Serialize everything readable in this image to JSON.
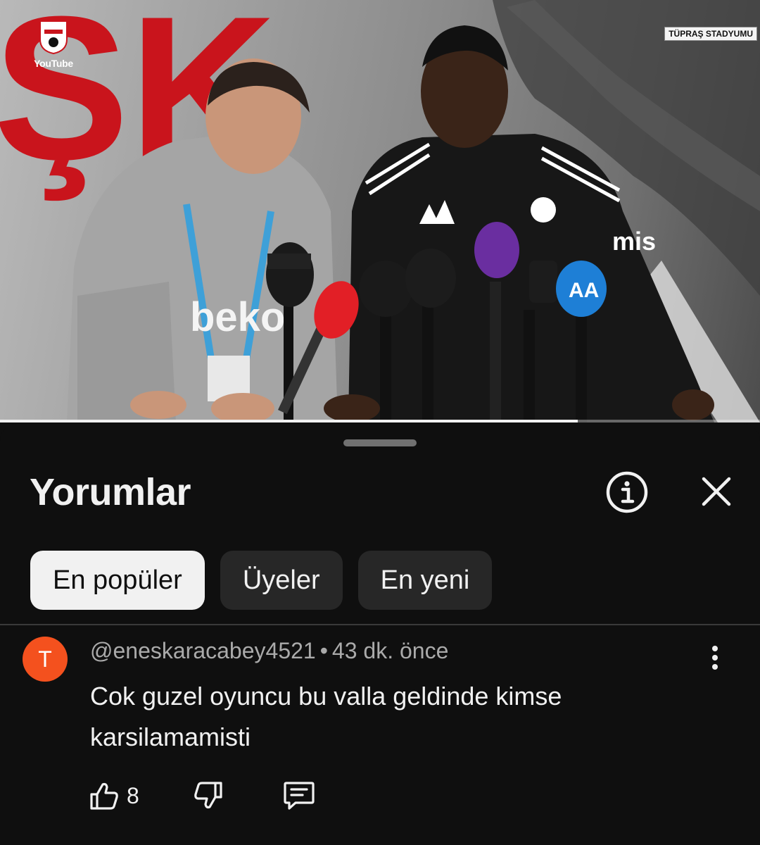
{
  "video": {
    "channel_logo_text": "YouTube",
    "stadium_label": "TÜPRAŞ STADYUMU",
    "backdrop_letters": "ŞK",
    "progress_fraction": 0.76
  },
  "comments_sheet": {
    "title": "Yorumlar",
    "icons": {
      "info": "info-icon",
      "close": "close-icon"
    },
    "filters": [
      {
        "label": "En popüler",
        "active": true
      },
      {
        "label": "Üyeler",
        "active": false
      },
      {
        "label": "En yeni",
        "active": false
      }
    ],
    "comment": {
      "avatar_letter": "T",
      "avatar_color": "#f4511e",
      "author": "@eneskaracabey4521",
      "separator": "•",
      "time": "43 dk. önce",
      "text": "Cok guzel oyuncu bu valla geldinde kimse karsilamamisti",
      "likes": "8",
      "icons": {
        "like": "thumbs-up-icon",
        "dislike": "thumbs-down-icon",
        "reply": "reply-icon",
        "more": "more-vert-icon"
      }
    }
  }
}
